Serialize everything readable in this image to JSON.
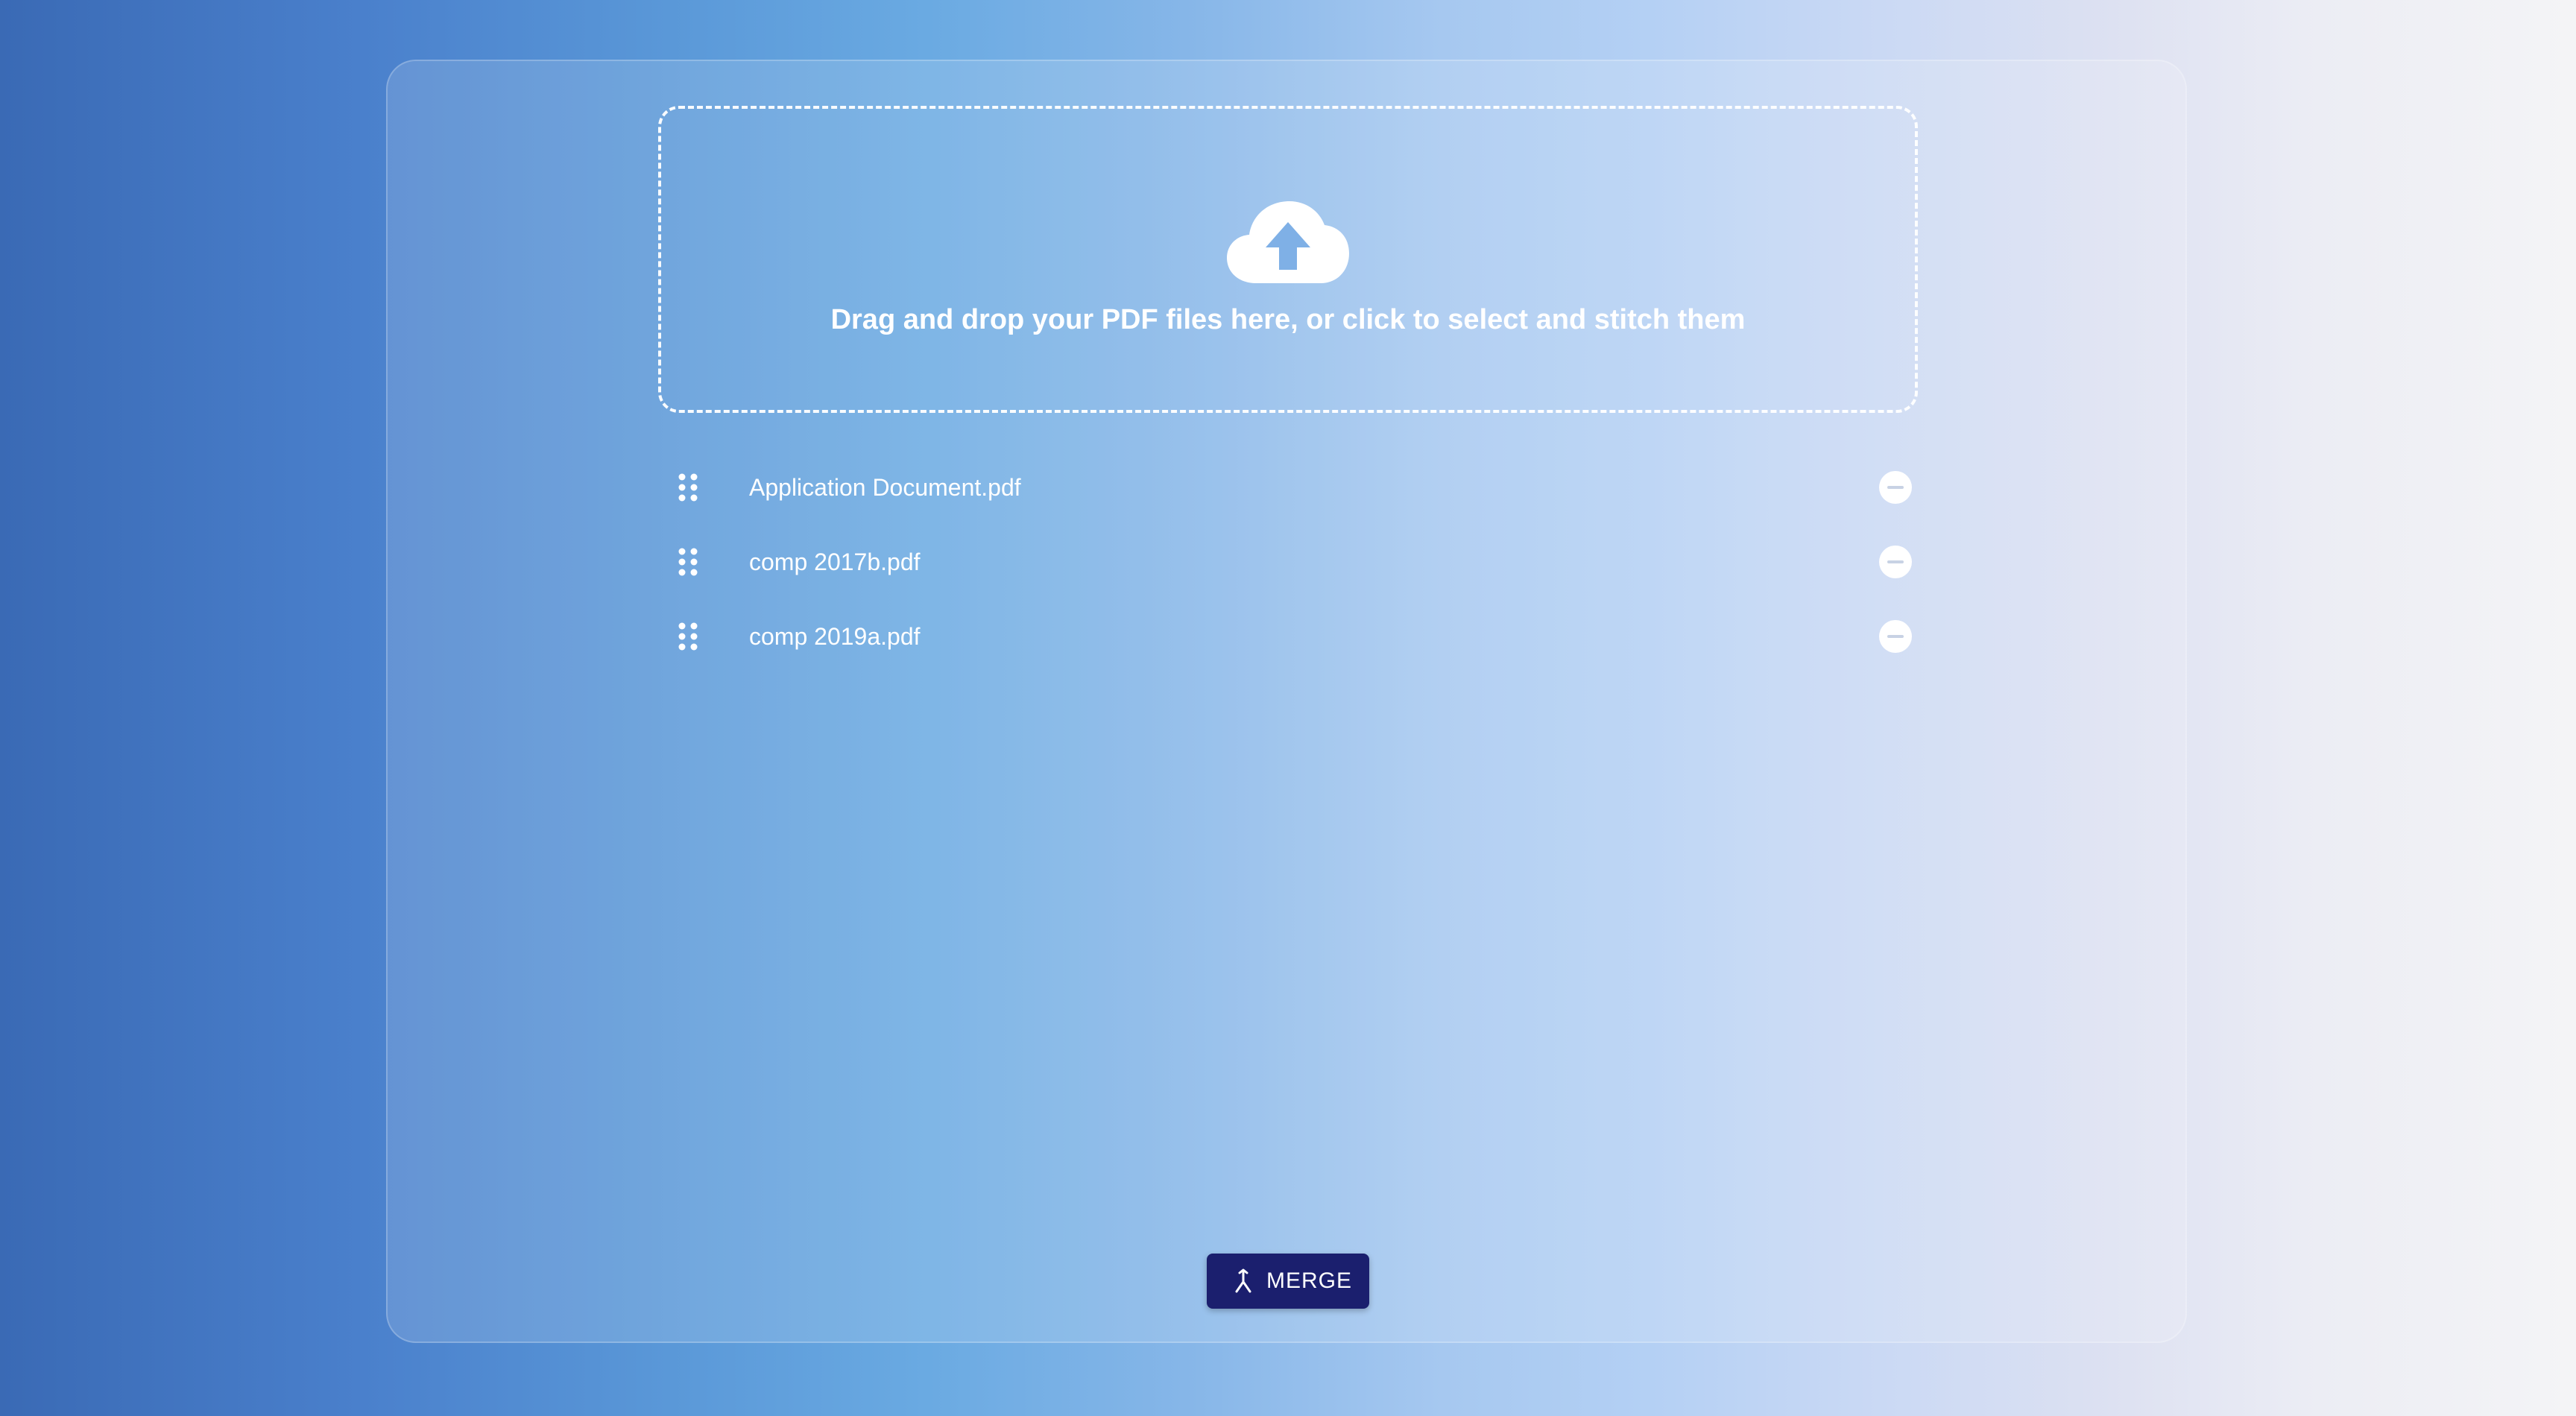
{
  "dropzone": {
    "icon": "cloud-upload-icon",
    "text": "Drag and drop your PDF files here, or click to select and stitch them"
  },
  "files": [
    {
      "name": "Application Document.pdf"
    },
    {
      "name": "comp 2017b.pdf"
    },
    {
      "name": "comp 2019a.pdf"
    }
  ],
  "file_row_icons": {
    "handle": "drag-handle-icon",
    "remove": "remove-circle-icon"
  },
  "merge_button": {
    "icon": "merge-icon",
    "label": "MERGE",
    "color": "#1b1f6e"
  },
  "colors": {
    "background_left": "#3a6ab5",
    "background_right": "#f4f4f6",
    "text": "#ffffff"
  }
}
